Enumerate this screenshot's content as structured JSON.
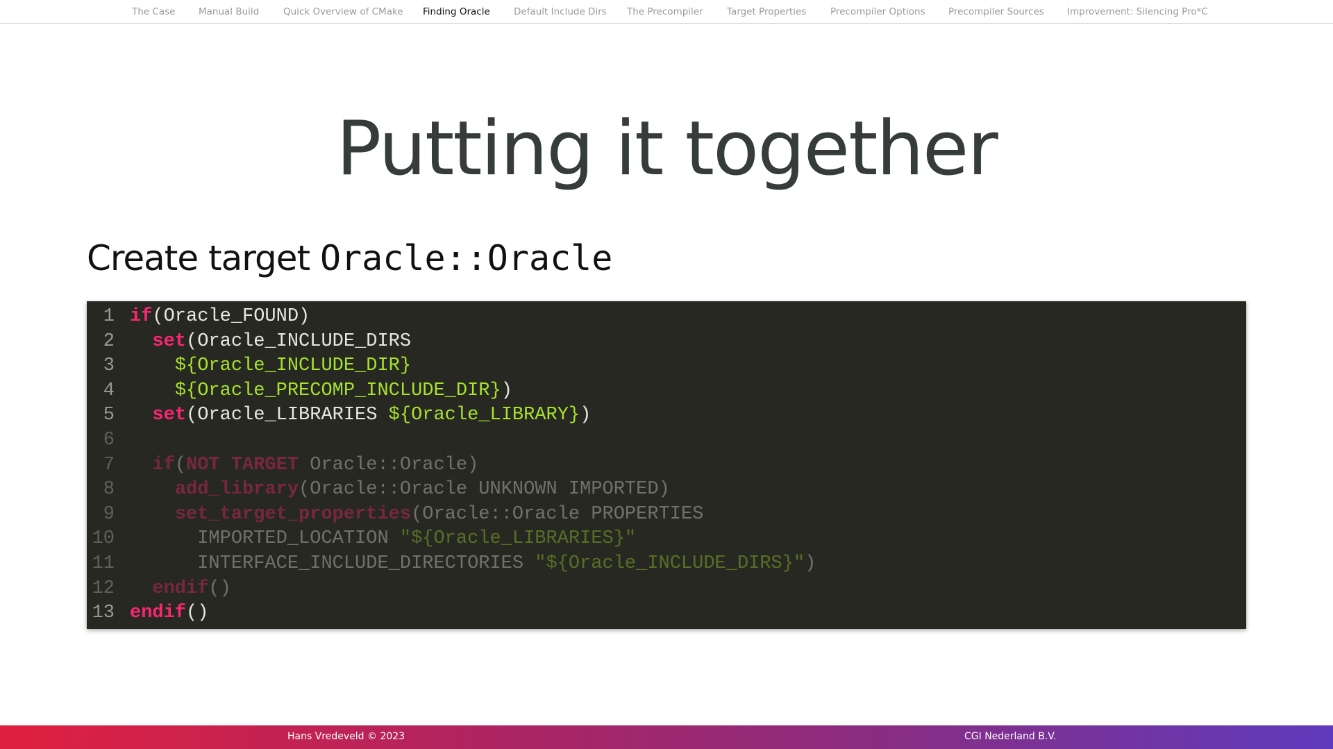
{
  "nav": {
    "items": [
      {
        "label": "The Case",
        "active": false
      },
      {
        "label": "Manual Build",
        "active": false
      },
      {
        "label": "Quick Overview of CMake",
        "active": false
      },
      {
        "label": "Finding Oracle",
        "active": true
      },
      {
        "label": "Default Include Dirs",
        "active": false
      },
      {
        "label": "The Precompiler",
        "active": false
      },
      {
        "label": "Target Properties",
        "active": false
      },
      {
        "label": "Precompiler Options",
        "active": false
      },
      {
        "label": "Precompiler Sources",
        "active": false
      },
      {
        "label": "Improvement: Silencing Pro*C",
        "active": false
      }
    ]
  },
  "slide": {
    "title": "Putting it together",
    "subtitle_text": "Create target ",
    "subtitle_code": "Oracle::Oracle"
  },
  "code": {
    "lines": [
      {
        "number": "1",
        "dim": false,
        "tokens": [
          {
            "t": "if",
            "k": "kw"
          },
          {
            "t": "(Oracle_FOUND)",
            "k": "plain"
          }
        ]
      },
      {
        "number": "2",
        "dim": false,
        "tokens": [
          {
            "t": "  ",
            "k": "plain"
          },
          {
            "t": "set",
            "k": "kw"
          },
          {
            "t": "(Oracle_INCLUDE_DIRS",
            "k": "plain"
          }
        ]
      },
      {
        "number": "3",
        "dim": false,
        "tokens": [
          {
            "t": "    ",
            "k": "plain"
          },
          {
            "t": "${Oracle_INCLUDE_DIR}",
            "k": "var"
          }
        ]
      },
      {
        "number": "4",
        "dim": false,
        "tokens": [
          {
            "t": "    ",
            "k": "plain"
          },
          {
            "t": "${Oracle_PRECOMP_INCLUDE_DIR}",
            "k": "var"
          },
          {
            "t": ")",
            "k": "plain"
          }
        ]
      },
      {
        "number": "5",
        "dim": false,
        "tokens": [
          {
            "t": "  ",
            "k": "plain"
          },
          {
            "t": "set",
            "k": "kw"
          },
          {
            "t": "(Oracle_LIBRARIES ",
            "k": "plain"
          },
          {
            "t": "${Oracle_LIBRARY}",
            "k": "var"
          },
          {
            "t": ")",
            "k": "plain"
          }
        ]
      },
      {
        "number": "6",
        "dim": true,
        "tokens": []
      },
      {
        "number": "7",
        "dim": true,
        "tokens": [
          {
            "t": "  ",
            "k": "plain"
          },
          {
            "t": "if",
            "k": "kw"
          },
          {
            "t": "(",
            "k": "plain"
          },
          {
            "t": "NOT TARGET",
            "k": "kw"
          },
          {
            "t": " Oracle::Oracle)",
            "k": "plain"
          }
        ]
      },
      {
        "number": "8",
        "dim": true,
        "tokens": [
          {
            "t": "    ",
            "k": "plain"
          },
          {
            "t": "add_library",
            "k": "kw"
          },
          {
            "t": "(Oracle::Oracle UNKNOWN IMPORTED)",
            "k": "plain"
          }
        ]
      },
      {
        "number": "9",
        "dim": true,
        "tokens": [
          {
            "t": "    ",
            "k": "plain"
          },
          {
            "t": "set_target_properties",
            "k": "kw"
          },
          {
            "t": "(Oracle::Oracle PROPERTIES",
            "k": "plain"
          }
        ]
      },
      {
        "number": "10",
        "dim": true,
        "tokens": [
          {
            "t": "      IMPORTED_LOCATION ",
            "k": "plain"
          },
          {
            "t": "\"${Oracle_LIBRARIES}\"",
            "k": "str"
          }
        ]
      },
      {
        "number": "11",
        "dim": true,
        "tokens": [
          {
            "t": "      INTERFACE_INCLUDE_DIRECTORIES ",
            "k": "plain"
          },
          {
            "t": "\"${Oracle_INCLUDE_DIRS}\"",
            "k": "str"
          },
          {
            "t": ")",
            "k": "plain"
          }
        ]
      },
      {
        "number": "12",
        "dim": true,
        "tokens": [
          {
            "t": "  ",
            "k": "plain"
          },
          {
            "t": "endif",
            "k": "kw"
          },
          {
            "t": "()",
            "k": "plain"
          }
        ]
      },
      {
        "number": "13",
        "dim": false,
        "tokens": [
          {
            "t": "endif",
            "k": "kw"
          },
          {
            "t": "()",
            "k": "plain"
          }
        ]
      }
    ]
  },
  "footer": {
    "left": "Hans Vredeveld © 2023",
    "right": "CGI Nederland B.V."
  },
  "colors": {
    "keyword": "#f92672",
    "variable": "#a6e22e",
    "code_bg": "#272822",
    "footer_start": "#e0203f",
    "footer_end": "#5f3bbd"
  }
}
